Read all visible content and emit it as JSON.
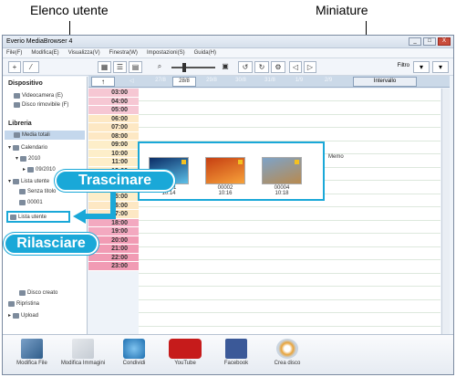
{
  "callouts": {
    "user_list": "Elenco utente",
    "thumbnails": "Miniature"
  },
  "window": {
    "title": "Everio MediaBrowser 4",
    "buttons": [
      "_",
      "□",
      "X"
    ]
  },
  "menu": [
    "File(F)",
    "Modifica(E)",
    "Visualizza(V)",
    "Finestra(W)",
    "Impostazioni(S)",
    "Guida(H)"
  ],
  "toolbar": {
    "add": "+ ",
    "filter_label": "Filtro"
  },
  "sidebar": {
    "device_head": "Dispositivo",
    "device_items": [
      "Videocamera (E)",
      "Disco rimovibile (F)"
    ],
    "library_head": "Libreria",
    "library_items": [
      "Media totali",
      "Calendario",
      "2010",
      "09/2010",
      "Lista utente",
      "Senza titolo",
      "00001",
      "Lista utente",
      "Disco creato",
      "Ripristina",
      "Upload"
    ]
  },
  "datebar": {
    "up": "↑",
    "dates": [
      "27/8",
      "28/8",
      "29/8",
      "30/8",
      "31/8",
      "1/9",
      "2/9"
    ],
    "active_index": 2,
    "right": "Intervallo"
  },
  "times": [
    "03:00",
    "04:00",
    "05:00",
    "06:00",
    "07:00",
    "08:00",
    "09:00",
    "10:00",
    "11:00",
    "12:00",
    "13:00",
    "14:00",
    "15:00",
    "16:00",
    "17:00",
    "18:00",
    "19:00",
    "20:00",
    "21:00",
    "22:00",
    "23:00"
  ],
  "thumbs": [
    {
      "id": "00001",
      "time": "10:14",
      "colors": [
        "#0a2c66",
        "#5dc0e8"
      ]
    },
    {
      "id": "00002",
      "time": "10:16",
      "colors": [
        "#c63f12",
        "#f7a23a"
      ]
    },
    {
      "id": "00004",
      "time": "10:18",
      "colors": [
        "#7da3c9",
        "#b88a4f"
      ]
    }
  ],
  "memo": "Memo",
  "drag_label": "Trascinare",
  "drop_label": "Rilasciare",
  "bottom_buttons": [
    "Modifica File",
    "Modifica Immagini",
    "Condividi",
    "YouTube",
    "Facebook",
    "Crea disco"
  ]
}
